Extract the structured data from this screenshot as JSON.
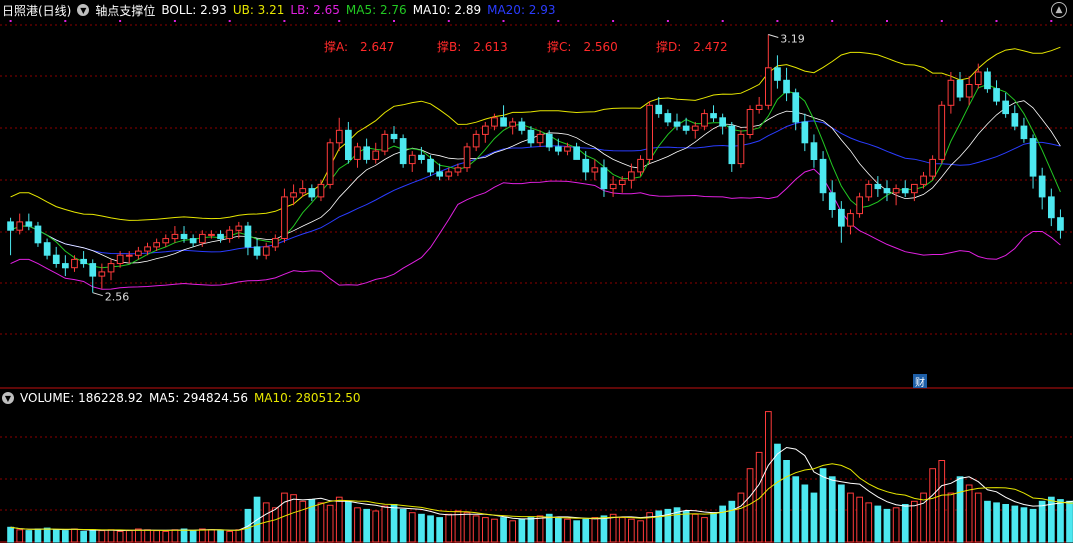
{
  "title": "日照港(日线)",
  "indicator_name": "轴点支撑位",
  "boll": {
    "label_boll": "BOLL: 2.93",
    "label_ub": "UB: 3.21",
    "label_lb": "LB: 2.65",
    "label_ma5": "MA5: 2.76",
    "label_ma10": "MA10: 2.89",
    "label_ma20": "MA20: 2.93"
  },
  "supports": [
    {
      "label": "撑A:",
      "value": "2.647"
    },
    {
      "label": "撑B:",
      "value": "2.613"
    },
    {
      "label": "撑C:",
      "value": "2.560"
    },
    {
      "label": "撑D:",
      "value": "2.472"
    }
  ],
  "volume": {
    "label_vol": "VOLUME: 186228.92",
    "label_ma5": "MA5: 294824.56",
    "label_ma10": "MA10: 280512.50"
  },
  "annotations": {
    "high": "3.19",
    "low": "2.56"
  },
  "cai_badge": "财",
  "colors": {
    "up": "#ff3b3b",
    "down": "#4de8f0",
    "grid": "#8b0000",
    "ma5": "#22c822",
    "ma10": "#ffffff",
    "ma20": "#2a3cff",
    "ub": "#e6e600",
    "lb": "#e020e0",
    "text": "#ffffff"
  },
  "chart_data": {
    "type": "candlestick",
    "y_high": 3.19,
    "y_low": 2.56,
    "candles": [
      [
        2.74,
        2.75,
        2.66,
        2.72
      ],
      [
        2.72,
        2.76,
        2.71,
        2.74
      ],
      [
        2.74,
        2.76,
        2.72,
        2.73
      ],
      [
        2.73,
        2.74,
        2.68,
        2.69
      ],
      [
        2.69,
        2.7,
        2.65,
        2.66
      ],
      [
        2.66,
        2.68,
        2.63,
        2.64
      ],
      [
        2.64,
        2.66,
        2.61,
        2.63
      ],
      [
        2.63,
        2.66,
        2.62,
        2.65
      ],
      [
        2.65,
        2.67,
        2.63,
        2.64
      ],
      [
        2.64,
        2.65,
        2.57,
        2.61
      ],
      [
        2.61,
        2.64,
        2.58,
        2.62
      ],
      [
        2.62,
        2.65,
        2.6,
        2.64
      ],
      [
        2.64,
        2.67,
        2.63,
        2.66
      ],
      [
        2.66,
        2.67,
        2.64,
        2.66
      ],
      [
        2.66,
        2.68,
        2.65,
        2.67
      ],
      [
        2.67,
        2.69,
        2.66,
        2.68
      ],
      [
        2.68,
        2.7,
        2.67,
        2.69
      ],
      [
        2.69,
        2.71,
        2.68,
        2.7
      ],
      [
        2.7,
        2.73,
        2.69,
        2.71
      ],
      [
        2.71,
        2.73,
        2.69,
        2.7
      ],
      [
        2.7,
        2.71,
        2.68,
        2.69
      ],
      [
        2.69,
        2.72,
        2.68,
        2.71
      ],
      [
        2.71,
        2.72,
        2.7,
        2.71
      ],
      [
        2.71,
        2.72,
        2.69,
        2.7
      ],
      [
        2.7,
        2.73,
        2.69,
        2.72
      ],
      [
        2.72,
        2.74,
        2.7,
        2.73
      ],
      [
        2.73,
        2.74,
        2.66,
        2.68
      ],
      [
        2.68,
        2.7,
        2.65,
        2.66
      ],
      [
        2.66,
        2.69,
        2.65,
        2.68
      ],
      [
        2.68,
        2.71,
        2.67,
        2.7
      ],
      [
        2.7,
        2.82,
        2.69,
        2.8
      ],
      [
        2.8,
        2.83,
        2.78,
        2.81
      ],
      [
        2.81,
        2.84,
        2.8,
        2.82
      ],
      [
        2.82,
        2.83,
        2.79,
        2.8
      ],
      [
        2.8,
        2.84,
        2.79,
        2.83
      ],
      [
        2.83,
        2.94,
        2.82,
        2.93
      ],
      [
        2.93,
        2.99,
        2.91,
        2.96
      ],
      [
        2.96,
        2.98,
        2.88,
        2.89
      ],
      [
        2.89,
        2.93,
        2.87,
        2.92
      ],
      [
        2.92,
        2.94,
        2.88,
        2.89
      ],
      [
        2.89,
        2.93,
        2.88,
        2.91
      ],
      [
        2.91,
        2.96,
        2.9,
        2.95
      ],
      [
        2.95,
        2.97,
        2.93,
        2.94
      ],
      [
        2.94,
        2.95,
        2.87,
        2.88
      ],
      [
        2.88,
        2.91,
        2.86,
        2.9
      ],
      [
        2.9,
        2.92,
        2.88,
        2.89
      ],
      [
        2.89,
        2.9,
        2.85,
        2.86
      ],
      [
        2.86,
        2.88,
        2.84,
        2.85
      ],
      [
        2.85,
        2.87,
        2.84,
        2.86
      ],
      [
        2.86,
        2.88,
        2.85,
        2.87
      ],
      [
        2.87,
        2.93,
        2.86,
        2.92
      ],
      [
        2.92,
        2.96,
        2.91,
        2.95
      ],
      [
        2.95,
        2.98,
        2.93,
        2.97
      ],
      [
        2.97,
        3.0,
        2.96,
        2.99
      ],
      [
        2.99,
        3.02,
        2.97,
        2.97
      ],
      [
        2.97,
        2.99,
        2.95,
        2.98
      ],
      [
        2.98,
        2.99,
        2.95,
        2.96
      ],
      [
        2.96,
        2.97,
        2.92,
        2.93
      ],
      [
        2.93,
        2.96,
        2.92,
        2.95
      ],
      [
        2.95,
        2.96,
        2.91,
        2.92
      ],
      [
        2.92,
        2.94,
        2.9,
        2.91
      ],
      [
        2.91,
        2.93,
        2.9,
        2.92
      ],
      [
        2.92,
        2.93,
        2.89,
        2.89
      ],
      [
        2.89,
        2.91,
        2.84,
        2.86
      ],
      [
        2.86,
        2.89,
        2.84,
        2.87
      ],
      [
        2.87,
        2.89,
        2.8,
        2.82
      ],
      [
        2.82,
        2.85,
        2.8,
        2.83
      ],
      [
        2.83,
        2.85,
        2.81,
        2.84
      ],
      [
        2.84,
        2.88,
        2.82,
        2.86
      ],
      [
        2.86,
        2.9,
        2.85,
        2.89
      ],
      [
        2.89,
        3.03,
        2.88,
        3.02
      ],
      [
        3.02,
        3.04,
        2.99,
        3.0
      ],
      [
        3.0,
        3.01,
        2.97,
        2.98
      ],
      [
        2.98,
        3.0,
        2.96,
        2.97
      ],
      [
        2.97,
        2.99,
        2.95,
        2.96
      ],
      [
        2.96,
        2.98,
        2.94,
        2.97
      ],
      [
        2.97,
        3.01,
        2.96,
        3.0
      ],
      [
        3.0,
        3.02,
        2.98,
        2.99
      ],
      [
        2.99,
        3.0,
        2.95,
        2.97
      ],
      [
        2.97,
        2.98,
        2.86,
        2.88
      ],
      [
        2.88,
        2.96,
        2.87,
        2.95
      ],
      [
        2.95,
        3.02,
        2.94,
        3.01
      ],
      [
        3.01,
        3.04,
        3.0,
        3.02
      ],
      [
        3.02,
        3.19,
        3.01,
        3.11
      ],
      [
        3.11,
        3.14,
        3.06,
        3.08
      ],
      [
        3.08,
        3.11,
        3.03,
        3.05
      ],
      [
        3.05,
        3.06,
        2.96,
        2.98
      ],
      [
        2.98,
        3.0,
        2.91,
        2.93
      ],
      [
        2.93,
        2.95,
        2.87,
        2.89
      ],
      [
        2.89,
        2.91,
        2.79,
        2.81
      ],
      [
        2.81,
        2.84,
        2.75,
        2.77
      ],
      [
        2.77,
        2.79,
        2.69,
        2.73
      ],
      [
        2.73,
        2.77,
        2.71,
        2.76
      ],
      [
        2.76,
        2.81,
        2.75,
        2.8
      ],
      [
        2.8,
        2.84,
        2.79,
        2.83
      ],
      [
        2.83,
        2.85,
        2.8,
        2.82
      ],
      [
        2.82,
        2.84,
        2.79,
        2.81
      ],
      [
        2.81,
        2.83,
        2.78,
        2.82
      ],
      [
        2.82,
        2.84,
        2.8,
        2.81
      ],
      [
        2.81,
        2.83,
        2.79,
        2.83
      ],
      [
        2.83,
        2.86,
        2.82,
        2.85
      ],
      [
        2.85,
        2.9,
        2.84,
        2.89
      ],
      [
        2.89,
        3.03,
        2.88,
        3.02
      ],
      [
        3.02,
        3.1,
        3.0,
        3.08
      ],
      [
        3.08,
        3.1,
        3.03,
        3.04
      ],
      [
        3.04,
        3.09,
        3.02,
        3.07
      ],
      [
        3.07,
        3.12,
        3.06,
        3.1
      ],
      [
        3.1,
        3.11,
        3.05,
        3.06
      ],
      [
        3.06,
        3.08,
        3.02,
        3.03
      ],
      [
        3.03,
        3.05,
        2.99,
        3.0
      ],
      [
        3.0,
        3.02,
        2.96,
        2.97
      ],
      [
        2.97,
        2.99,
        2.93,
        2.94
      ],
      [
        2.94,
        2.95,
        2.82,
        2.85
      ],
      [
        2.85,
        2.87,
        2.77,
        2.8
      ],
      [
        2.8,
        2.82,
        2.73,
        2.75
      ],
      [
        2.75,
        2.77,
        2.7,
        2.72
      ]
    ],
    "volume": [
      18,
      15,
      14,
      16,
      17,
      15,
      14,
      16,
      13,
      15,
      14,
      15,
      13,
      14,
      16,
      15,
      14,
      13,
      15,
      16,
      14,
      16,
      15,
      14,
      13,
      15,
      40,
      55,
      48,
      42,
      60,
      58,
      50,
      52,
      48,
      45,
      55,
      50,
      42,
      40,
      38,
      44,
      46,
      40,
      36,
      34,
      32,
      30,
      34,
      38,
      36,
      32,
      30,
      28,
      30,
      26,
      28,
      30,
      32,
      34,
      30,
      28,
      26,
      28,
      30,
      32,
      34,
      30,
      28,
      26,
      36,
      38,
      40,
      42,
      38,
      34,
      30,
      36,
      44,
      50,
      60,
      90,
      110,
      160,
      120,
      100,
      80,
      70,
      60,
      90,
      80,
      70,
      60,
      55,
      48,
      44,
      40,
      42,
      46,
      50,
      60,
      90,
      100,
      60,
      80,
      70,
      60,
      50,
      48,
      46,
      44,
      42,
      40,
      50,
      55,
      52,
      50,
      48
    ]
  }
}
